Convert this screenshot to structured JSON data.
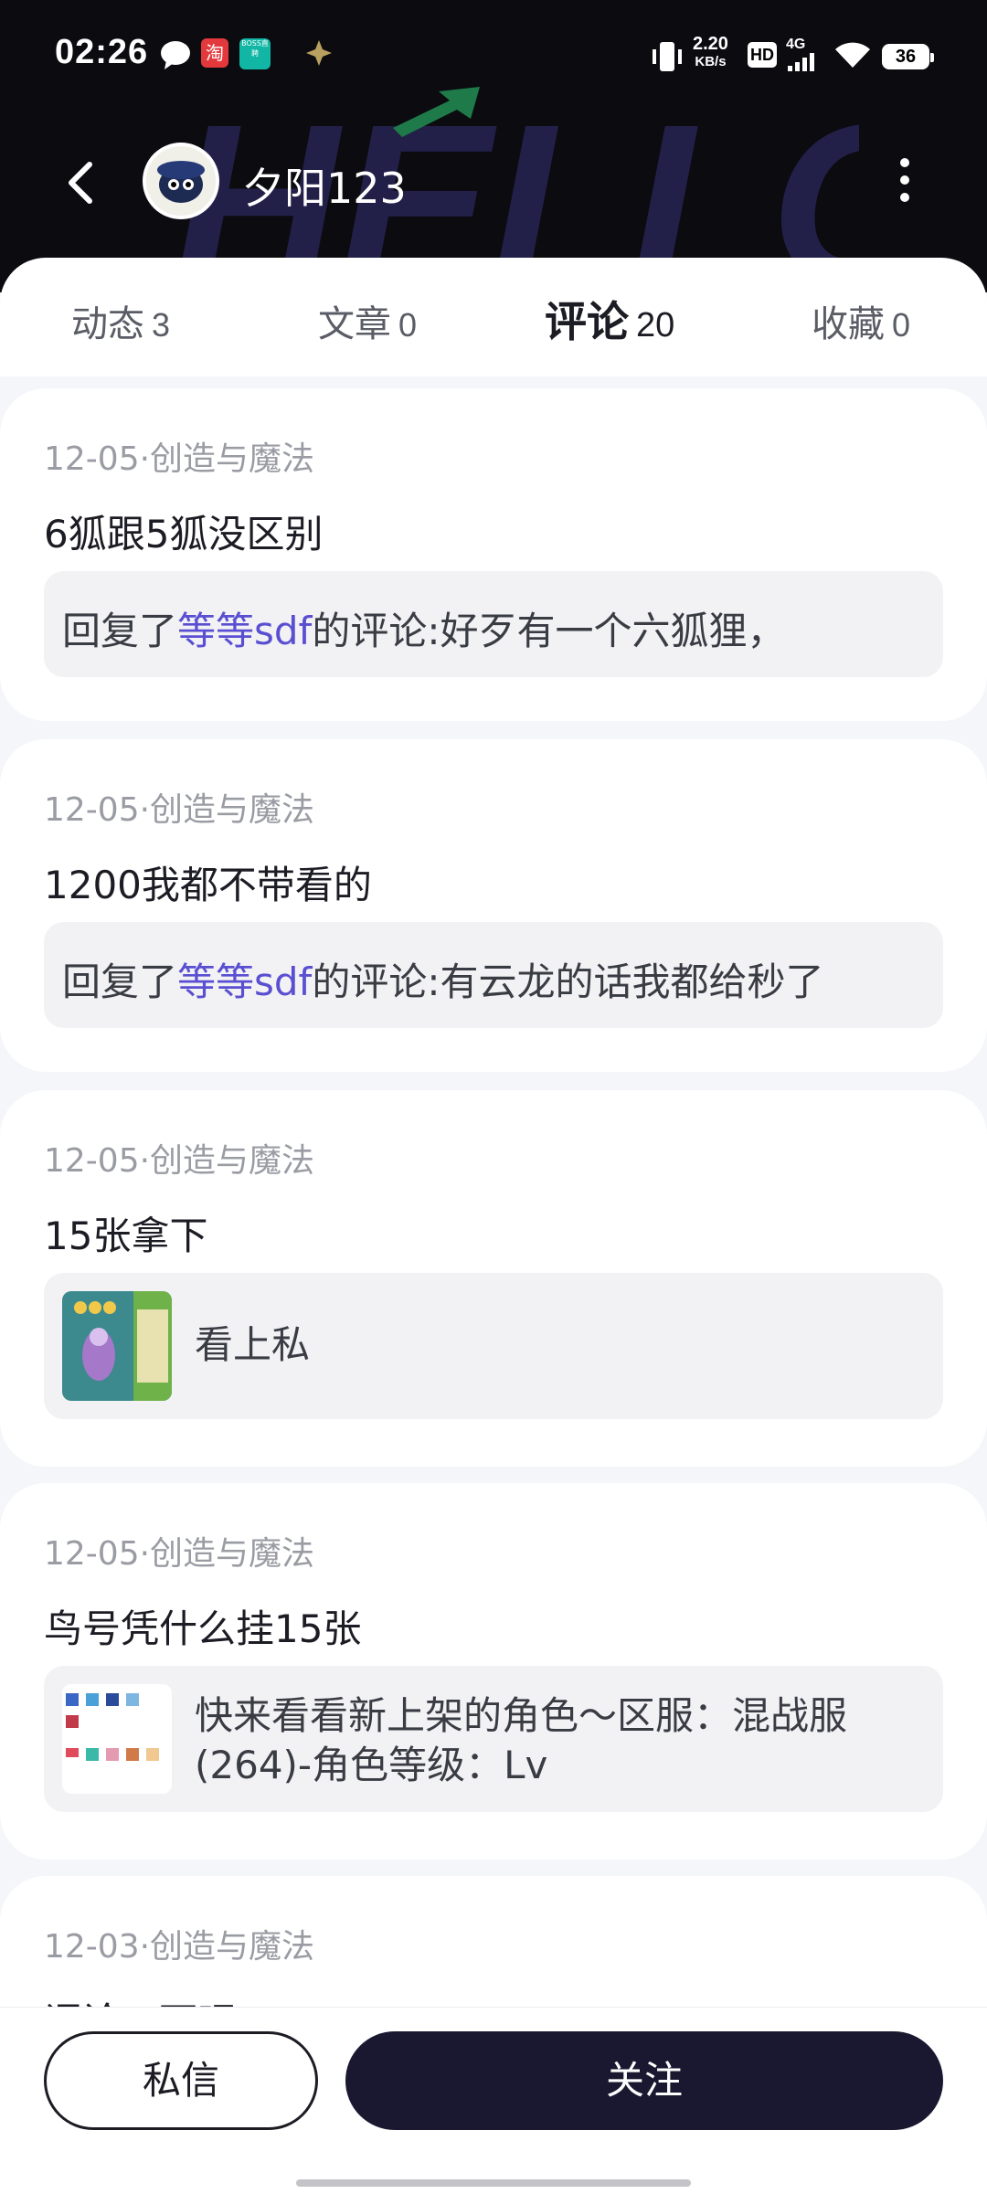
{
  "status_bar": {
    "time": "02:26",
    "net_speed_value": "2.20",
    "net_speed_unit": "KB/s",
    "hd_label": "HD",
    "net_type": "4G",
    "battery": "36",
    "notif_app_1": "淘",
    "notif_app_2": "BOSS直聘"
  },
  "header": {
    "username": "夕阳123",
    "banner_text": "HELLO."
  },
  "tabs": [
    {
      "label": "动态",
      "count": "3"
    },
    {
      "label": "文章",
      "count": "0"
    },
    {
      "label": "评论",
      "count": "20"
    },
    {
      "label": "收藏",
      "count": "0"
    }
  ],
  "comments": [
    {
      "meta": "12-05·创造与魔法",
      "text": "6狐跟5狐没区别",
      "reply_prefix": "回复了",
      "reply_user": "等等sdf",
      "reply_suffix": "的评论:好歹有一个六狐狸，"
    },
    {
      "meta": "12-05·创造与魔法",
      "text": "1200我都不带看的",
      "reply_prefix": "回复了",
      "reply_user": "等等sdf",
      "reply_suffix": "的评论:有云龙的话我都给秒了"
    },
    {
      "meta": "12-05·创造与魔法",
      "text": "15张拿下",
      "quote_text": "看上私"
    },
    {
      "meta": "12-05·创造与魔法",
      "text": "鸟号凭什么挂15张",
      "quote_line1": "快来看看新上架的角色～区服：混战服",
      "quote_line2": "(264)-角色等级：Lv"
    },
    {
      "meta": "12-03·创造与魔法",
      "text": "评论一下吧"
    }
  ],
  "bottom": {
    "message_label": "私信",
    "follow_label": "关注"
  },
  "colors": {
    "accent_link": "#5a4fd1",
    "tab_highlight": "#c9b6f6",
    "follow_button": "#1a1830"
  }
}
